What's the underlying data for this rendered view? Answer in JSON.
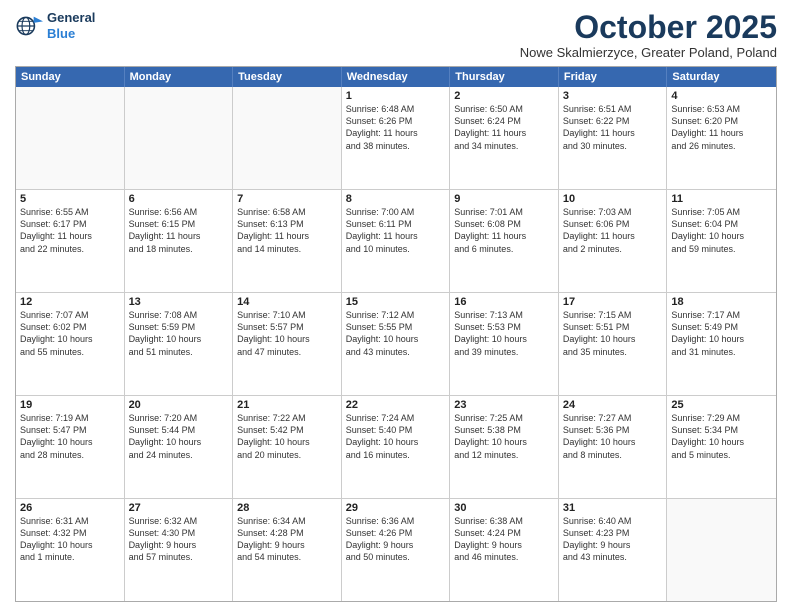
{
  "logo": {
    "line1": "General",
    "line2": "Blue"
  },
  "title": "October 2025",
  "subtitle": "Nowe Skalmierzyce, Greater Poland, Poland",
  "header_days": [
    "Sunday",
    "Monday",
    "Tuesday",
    "Wednesday",
    "Thursday",
    "Friday",
    "Saturday"
  ],
  "rows": [
    [
      {
        "day": "",
        "text": ""
      },
      {
        "day": "",
        "text": ""
      },
      {
        "day": "",
        "text": ""
      },
      {
        "day": "1",
        "text": "Sunrise: 6:48 AM\nSunset: 6:26 PM\nDaylight: 11 hours\nand 38 minutes."
      },
      {
        "day": "2",
        "text": "Sunrise: 6:50 AM\nSunset: 6:24 PM\nDaylight: 11 hours\nand 34 minutes."
      },
      {
        "day": "3",
        "text": "Sunrise: 6:51 AM\nSunset: 6:22 PM\nDaylight: 11 hours\nand 30 minutes."
      },
      {
        "day": "4",
        "text": "Sunrise: 6:53 AM\nSunset: 6:20 PM\nDaylight: 11 hours\nand 26 minutes."
      }
    ],
    [
      {
        "day": "5",
        "text": "Sunrise: 6:55 AM\nSunset: 6:17 PM\nDaylight: 11 hours\nand 22 minutes."
      },
      {
        "day": "6",
        "text": "Sunrise: 6:56 AM\nSunset: 6:15 PM\nDaylight: 11 hours\nand 18 minutes."
      },
      {
        "day": "7",
        "text": "Sunrise: 6:58 AM\nSunset: 6:13 PM\nDaylight: 11 hours\nand 14 minutes."
      },
      {
        "day": "8",
        "text": "Sunrise: 7:00 AM\nSunset: 6:11 PM\nDaylight: 11 hours\nand 10 minutes."
      },
      {
        "day": "9",
        "text": "Sunrise: 7:01 AM\nSunset: 6:08 PM\nDaylight: 11 hours\nand 6 minutes."
      },
      {
        "day": "10",
        "text": "Sunrise: 7:03 AM\nSunset: 6:06 PM\nDaylight: 11 hours\nand 2 minutes."
      },
      {
        "day": "11",
        "text": "Sunrise: 7:05 AM\nSunset: 6:04 PM\nDaylight: 10 hours\nand 59 minutes."
      }
    ],
    [
      {
        "day": "12",
        "text": "Sunrise: 7:07 AM\nSunset: 6:02 PM\nDaylight: 10 hours\nand 55 minutes."
      },
      {
        "day": "13",
        "text": "Sunrise: 7:08 AM\nSunset: 5:59 PM\nDaylight: 10 hours\nand 51 minutes."
      },
      {
        "day": "14",
        "text": "Sunrise: 7:10 AM\nSunset: 5:57 PM\nDaylight: 10 hours\nand 47 minutes."
      },
      {
        "day": "15",
        "text": "Sunrise: 7:12 AM\nSunset: 5:55 PM\nDaylight: 10 hours\nand 43 minutes."
      },
      {
        "day": "16",
        "text": "Sunrise: 7:13 AM\nSunset: 5:53 PM\nDaylight: 10 hours\nand 39 minutes."
      },
      {
        "day": "17",
        "text": "Sunrise: 7:15 AM\nSunset: 5:51 PM\nDaylight: 10 hours\nand 35 minutes."
      },
      {
        "day": "18",
        "text": "Sunrise: 7:17 AM\nSunset: 5:49 PM\nDaylight: 10 hours\nand 31 minutes."
      }
    ],
    [
      {
        "day": "19",
        "text": "Sunrise: 7:19 AM\nSunset: 5:47 PM\nDaylight: 10 hours\nand 28 minutes."
      },
      {
        "day": "20",
        "text": "Sunrise: 7:20 AM\nSunset: 5:44 PM\nDaylight: 10 hours\nand 24 minutes."
      },
      {
        "day": "21",
        "text": "Sunrise: 7:22 AM\nSunset: 5:42 PM\nDaylight: 10 hours\nand 20 minutes."
      },
      {
        "day": "22",
        "text": "Sunrise: 7:24 AM\nSunset: 5:40 PM\nDaylight: 10 hours\nand 16 minutes."
      },
      {
        "day": "23",
        "text": "Sunrise: 7:25 AM\nSunset: 5:38 PM\nDaylight: 10 hours\nand 12 minutes."
      },
      {
        "day": "24",
        "text": "Sunrise: 7:27 AM\nSunset: 5:36 PM\nDaylight: 10 hours\nand 8 minutes."
      },
      {
        "day": "25",
        "text": "Sunrise: 7:29 AM\nSunset: 5:34 PM\nDaylight: 10 hours\nand 5 minutes."
      }
    ],
    [
      {
        "day": "26",
        "text": "Sunrise: 6:31 AM\nSunset: 4:32 PM\nDaylight: 10 hours\nand 1 minute."
      },
      {
        "day": "27",
        "text": "Sunrise: 6:32 AM\nSunset: 4:30 PM\nDaylight: 9 hours\nand 57 minutes."
      },
      {
        "day": "28",
        "text": "Sunrise: 6:34 AM\nSunset: 4:28 PM\nDaylight: 9 hours\nand 54 minutes."
      },
      {
        "day": "29",
        "text": "Sunrise: 6:36 AM\nSunset: 4:26 PM\nDaylight: 9 hours\nand 50 minutes."
      },
      {
        "day": "30",
        "text": "Sunrise: 6:38 AM\nSunset: 4:24 PM\nDaylight: 9 hours\nand 46 minutes."
      },
      {
        "day": "31",
        "text": "Sunrise: 6:40 AM\nSunset: 4:23 PM\nDaylight: 9 hours\nand 43 minutes."
      },
      {
        "day": "",
        "text": ""
      }
    ]
  ]
}
